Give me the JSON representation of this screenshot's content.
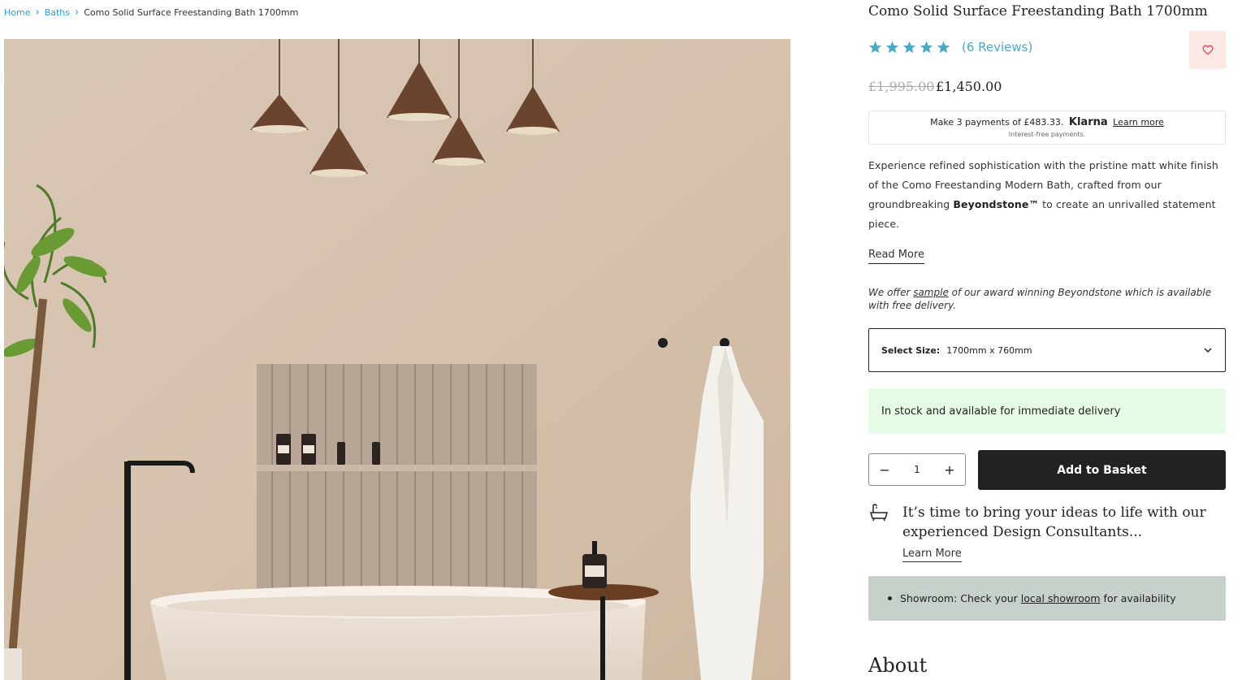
{
  "breadcrumb": {
    "items": [
      {
        "label": "Home"
      },
      {
        "label": "Baths"
      }
    ],
    "current": "Como Solid Surface Freestanding Bath 1700mm",
    "separator": "›"
  },
  "product": {
    "title": "Como Solid Surface Freestanding Bath 1700mm",
    "rating_stars": 5,
    "reviews_label": "(6 Reviews)",
    "price_old": "£1,995.00",
    "price_now": "£1,450.00",
    "wishlist_icon": "heart-icon"
  },
  "klarna": {
    "text": "Make 3 payments of £483.33.",
    "logo": "Klarna",
    "learn_more": "Learn more",
    "sub": "Interest-free payments."
  },
  "description": {
    "before": "Experience refined sophistication with the pristine matt white finish of the Como Freestanding Modern Bath, crafted from our groundbreaking ",
    "bold": "Beyondstone™",
    "after": " to create an unrivalled statement piece.",
    "read_more": "Read More"
  },
  "sample_note": {
    "before": "We offer ",
    "link": "sample",
    "after": " of our award winning Beyondstone which is available with free delivery."
  },
  "size_select": {
    "label": "Select Size:",
    "value": "1700mm x 760mm"
  },
  "stock": {
    "text": "In stock and available for immediate delivery"
  },
  "purchase": {
    "quantity": "1",
    "minus": "−",
    "plus": "+",
    "add_to_basket": "Add to Basket"
  },
  "consultants": {
    "text": "It’s time to bring your ideas to life with our experienced Design Consultants...",
    "learn_more": "Learn More",
    "icon": "bathtub-icon"
  },
  "showroom": {
    "before": "Showroom: Check your",
    "link": "local showroom",
    "after": "for availability"
  },
  "about_heading": "About",
  "colors": {
    "link_blue": "#2a9fd8",
    "star_blue": "#4aa8c9",
    "button_dark": "#222222",
    "stock_green_bg": "#e6fbe4",
    "showroom_bg": "#c7d0c9",
    "wishlist_bg": "#fde8e8",
    "heart": "#e0505a"
  }
}
